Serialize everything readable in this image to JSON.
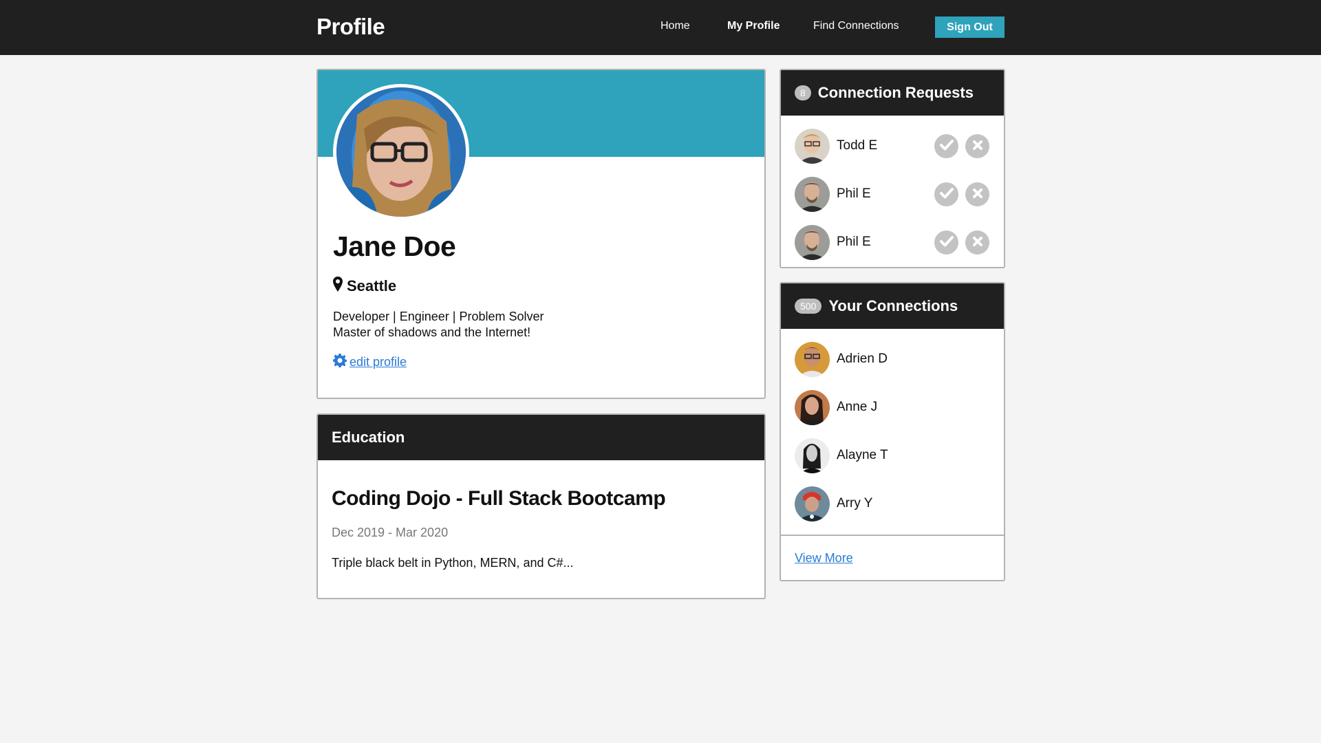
{
  "header": {
    "brand": "Profile",
    "nav": [
      {
        "label": "Home",
        "active": false
      },
      {
        "label": "My Profile",
        "active": true
      },
      {
        "label": "Find Connections",
        "active": false
      }
    ],
    "signout_label": "Sign Out"
  },
  "profile": {
    "name": "Jane Doe",
    "location": "Seattle",
    "bio_line1": "Developer | Engineer | Problem Solver",
    "bio_line2": "Master of shadows and the Internet!",
    "edit_label": " edit profile"
  },
  "education": {
    "heading": "Education",
    "school": "Coding Dojo - Full Stack Bootcamp",
    "dates": "Dec 2019 - Mar 2020",
    "description": "Triple black belt in Python, MERN, and C#..."
  },
  "requests": {
    "count": "8",
    "title": "Connection Requests",
    "items": [
      {
        "name": "Todd E"
      },
      {
        "name": "Phil E"
      },
      {
        "name": "Phil E"
      }
    ]
  },
  "connections": {
    "count": "500",
    "title": "Your Connections",
    "items": [
      {
        "name": "Adrien D"
      },
      {
        "name": "Anne J"
      },
      {
        "name": "Alayne T"
      },
      {
        "name": "Arry Y"
      }
    ],
    "view_more": "View More"
  },
  "colors": {
    "accent": "#2ea3bb",
    "dark": "#202020",
    "link": "#2a7ad8"
  },
  "icons": {
    "location": "map-marker-icon",
    "edit": "gear-icon",
    "accept": "check-circle-icon",
    "decline": "x-circle-icon"
  }
}
